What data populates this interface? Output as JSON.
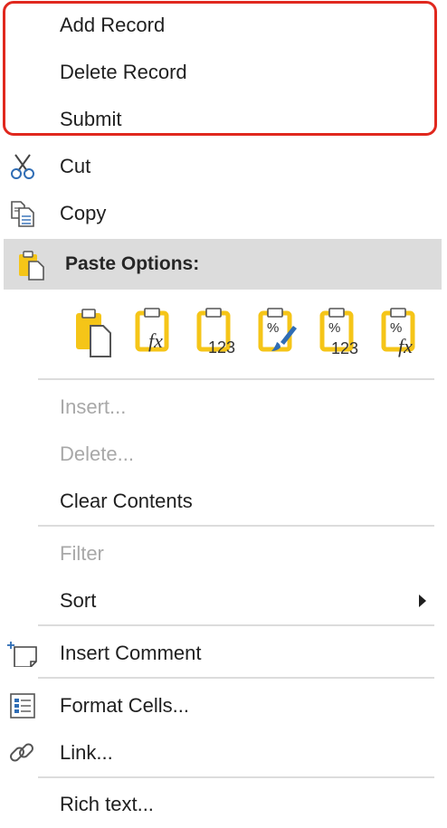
{
  "menu": {
    "custom_items": [
      "Add Record",
      "Delete Record",
      "Submit"
    ],
    "cut_label": "Cut",
    "copy_label": "Copy",
    "paste_options_label": "Paste Options:",
    "paste_options": [
      {
        "icon": "paste-icon"
      },
      {
        "icon": "paste-formulas-icon",
        "text": "fx"
      },
      {
        "icon": "paste-values-icon",
        "text": "123"
      },
      {
        "icon": "paste-formatting-icon",
        "text": "%"
      },
      {
        "icon": "paste-values-number-formatting-icon",
        "text": "%",
        "text2": "123"
      },
      {
        "icon": "paste-formulas-number-formatting-icon",
        "text": "%",
        "text2": "fx"
      }
    ],
    "insert_label": "Insert...",
    "delete_label": "Delete...",
    "clear_contents_label": "Clear Contents",
    "filter_label": "Filter",
    "sort_label": "Sort",
    "insert_comment_label": "Insert Comment",
    "format_cells_label": "Format Cells...",
    "link_label": "Link...",
    "rich_text_label": "Rich text..."
  },
  "colors": {
    "highlight_border": "#e0281e",
    "clipboard_yellow": "#f5c518",
    "icon_blue": "#2f6db5",
    "disabled_text": "#a8a8a8"
  }
}
